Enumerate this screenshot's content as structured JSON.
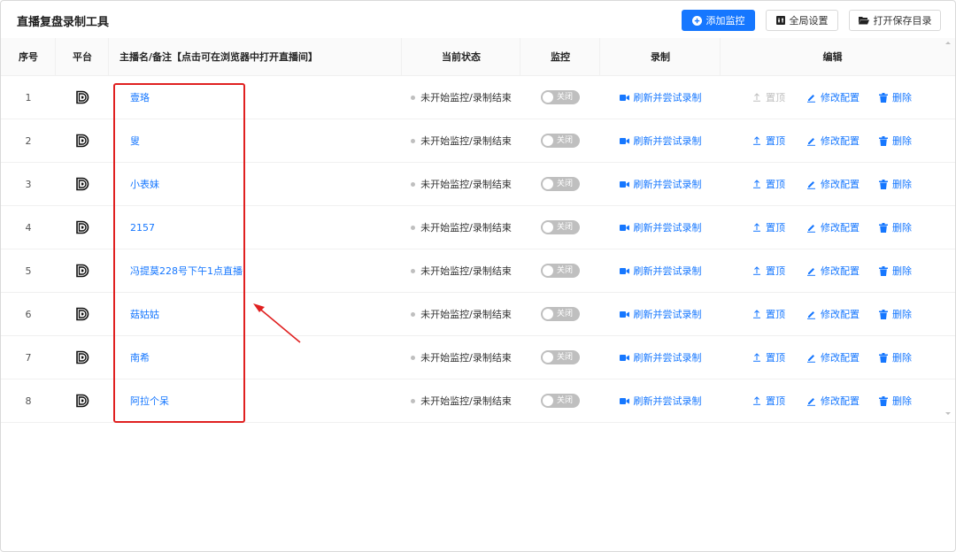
{
  "header": {
    "title": "直播复盘录制工具",
    "buttons": {
      "add": "添加监控",
      "settings": "全局设置",
      "open_folder": "打开保存目录"
    }
  },
  "table": {
    "columns": {
      "index": "序号",
      "platform": "平台",
      "name": "主播名/备注【点击可在浏览器中打开直播间】",
      "status": "当前状态",
      "monitor": "监控",
      "record": "录制",
      "edit": "编辑"
    },
    "rows": [
      {
        "index": "1",
        "name": "壹珞",
        "status": "未开始监控/录制结束",
        "monitor_label": "关闭",
        "record_label": "刷新并尝试录制",
        "pin_label": "置顶",
        "pin_disabled": true,
        "modify_label": "修改配置",
        "delete_label": "删除"
      },
      {
        "index": "2",
        "name": "叟",
        "status": "未开始监控/录制结束",
        "monitor_label": "关闭",
        "record_label": "刷新并尝试录制",
        "pin_label": "置顶",
        "pin_disabled": false,
        "modify_label": "修改配置",
        "delete_label": "删除"
      },
      {
        "index": "3",
        "name": "小表妹",
        "status": "未开始监控/录制结束",
        "monitor_label": "关闭",
        "record_label": "刷新并尝试录制",
        "pin_label": "置顶",
        "pin_disabled": false,
        "modify_label": "修改配置",
        "delete_label": "删除"
      },
      {
        "index": "4",
        "name": "2157",
        "status": "未开始监控/录制结束",
        "monitor_label": "关闭",
        "record_label": "刷新并尝试录制",
        "pin_label": "置顶",
        "pin_disabled": false,
        "modify_label": "修改配置",
        "delete_label": "删除"
      },
      {
        "index": "5",
        "name": "冯提莫228号下午1点直播",
        "status": "未开始监控/录制结束",
        "monitor_label": "关闭",
        "record_label": "刷新并尝试录制",
        "pin_label": "置顶",
        "pin_disabled": false,
        "modify_label": "修改配置",
        "delete_label": "删除"
      },
      {
        "index": "6",
        "name": "菇姑姑",
        "status": "未开始监控/录制结束",
        "monitor_label": "关闭",
        "record_label": "刷新并尝试录制",
        "pin_label": "置顶",
        "pin_disabled": false,
        "modify_label": "修改配置",
        "delete_label": "删除"
      },
      {
        "index": "7",
        "name": "南希",
        "status": "未开始监控/录制结束",
        "monitor_label": "关闭",
        "record_label": "刷新并尝试录制",
        "pin_label": "置顶",
        "pin_disabled": false,
        "modify_label": "修改配置",
        "delete_label": "删除"
      },
      {
        "index": "8",
        "name": "阿拉个呆",
        "status": "未开始监控/录制结束",
        "monitor_label": "关闭",
        "record_label": "刷新并尝试录制",
        "pin_label": "置顶",
        "pin_disabled": false,
        "modify_label": "修改配置",
        "delete_label": "删除"
      }
    ]
  },
  "icons": {
    "add": "plus-circle-icon",
    "settings": "settings-icon",
    "folder": "folder-open-icon",
    "platform": "douyu-logo-icon",
    "record": "video-camera-icon",
    "pin": "pin-top-icon",
    "modify": "edit-icon",
    "delete": "trash-icon"
  },
  "colors": {
    "primary": "#1677ff",
    "annotation": "#e02020",
    "switch_off": "#bfbfbf"
  }
}
